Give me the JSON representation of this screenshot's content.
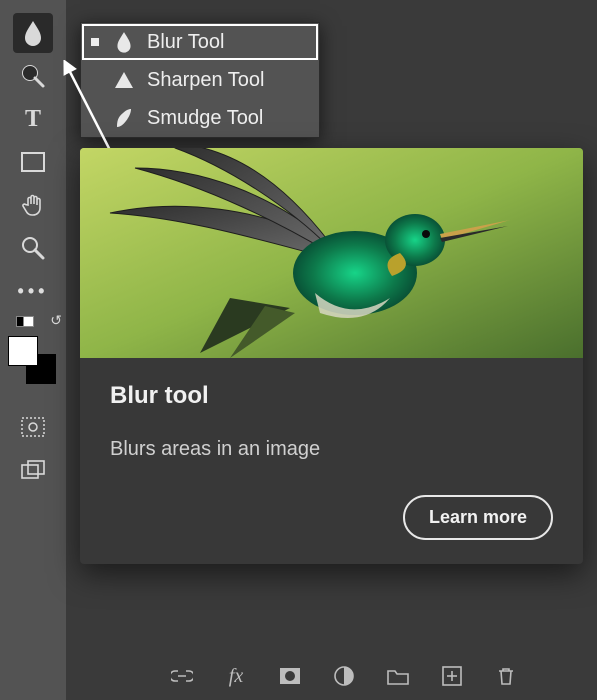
{
  "toolbar": {
    "active_tool": "blur",
    "tools": [
      {
        "id": "blur",
        "icon": "drop-icon"
      },
      {
        "id": "dodge",
        "icon": "dodge-icon"
      },
      {
        "id": "type",
        "icon": "type-icon"
      },
      {
        "id": "rectangle",
        "icon": "rectangle-icon"
      },
      {
        "id": "hand",
        "icon": "hand-icon"
      },
      {
        "id": "zoom",
        "icon": "zoom-icon"
      },
      {
        "id": "more",
        "icon": "more-icon"
      },
      {
        "id": "selection-mask",
        "icon": "selection-mask-icon"
      },
      {
        "id": "artboard",
        "icon": "artboard-icon"
      }
    ],
    "swatch": {
      "foreground": "#ffffff",
      "background": "#000000"
    }
  },
  "flyout": {
    "items": [
      {
        "label": "Blur Tool",
        "icon": "drop-icon",
        "selected": true
      },
      {
        "label": "Sharpen Tool",
        "icon": "triangle-icon",
        "selected": false
      },
      {
        "label": "Smudge Tool",
        "icon": "smudge-icon",
        "selected": false
      }
    ]
  },
  "tooltip": {
    "title": "Blur tool",
    "description": "Blurs areas in an image",
    "cta": "Learn more",
    "hero_alt": "hummingbird"
  },
  "bottom_icons": [
    "link-icon",
    "fx-icon",
    "mask-icon",
    "adjustment-icon",
    "group-icon",
    "new-layer-icon",
    "trash-icon"
  ]
}
